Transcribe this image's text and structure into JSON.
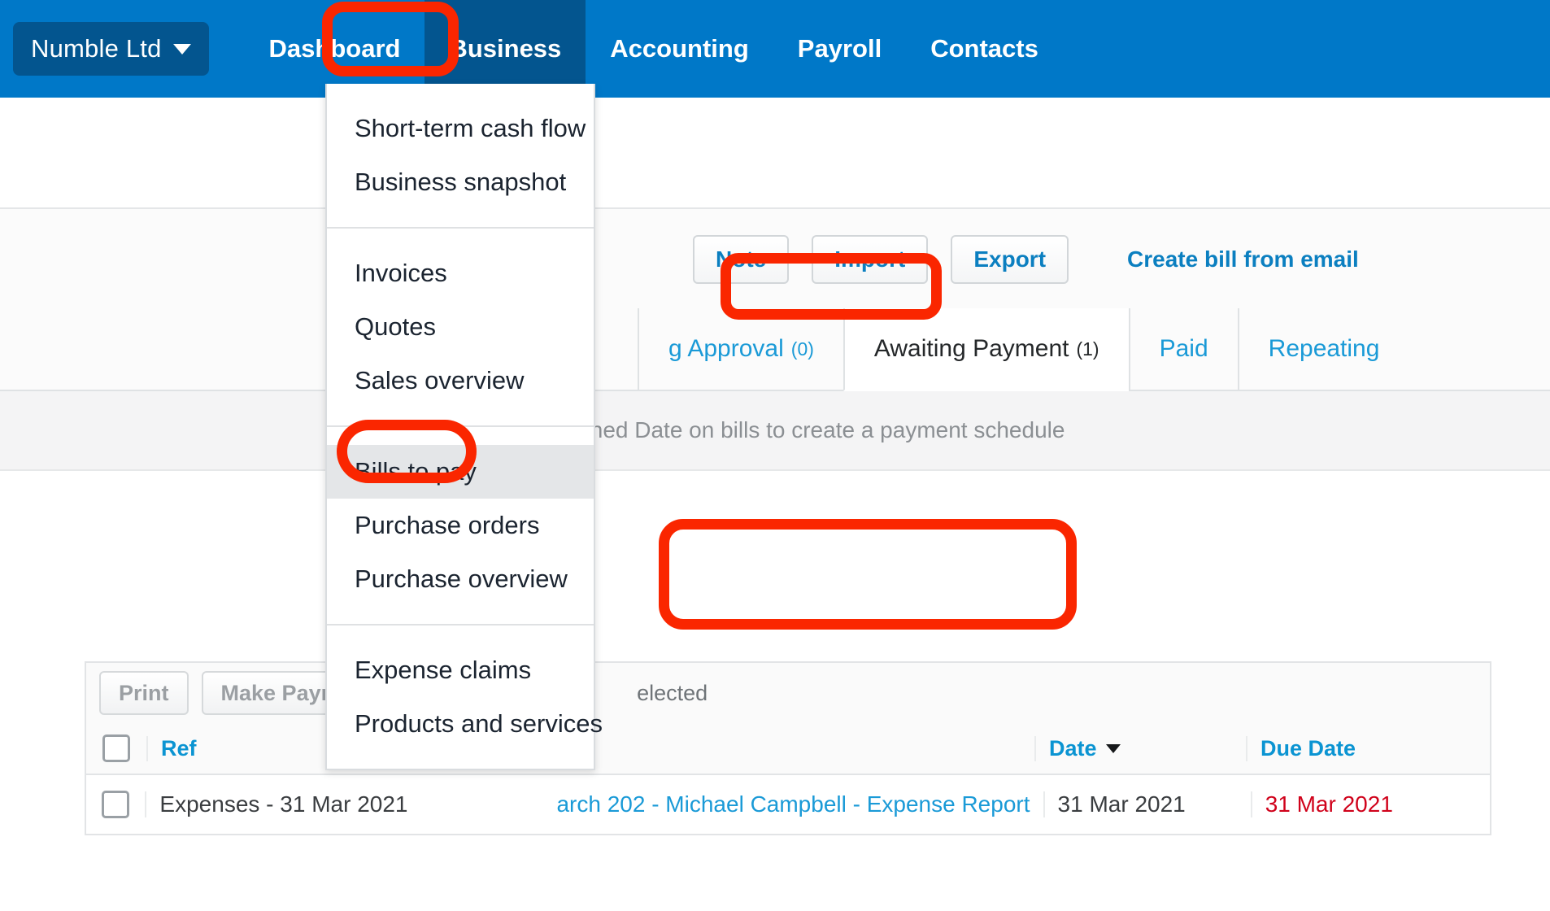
{
  "topnav": {
    "org": {
      "label": "Numble Ltd",
      "caret_icon": "chevron-down-icon"
    },
    "items": [
      {
        "label": "Dashboard",
        "active": false
      },
      {
        "label": "Business",
        "active": true
      },
      {
        "label": "Accounting",
        "active": false
      },
      {
        "label": "Payroll",
        "active": false
      },
      {
        "label": "Contacts",
        "active": false
      }
    ],
    "bg_color": "#0078c8",
    "active_bg_color": "#03558f"
  },
  "menu": {
    "groups": [
      {
        "items": [
          {
            "label": "Short-term cash flow",
            "highlighted": false
          },
          {
            "label": "Business snapshot",
            "highlighted": false
          }
        ]
      },
      {
        "items": [
          {
            "label": "Invoices",
            "highlighted": false
          },
          {
            "label": "Quotes",
            "highlighted": false
          },
          {
            "label": "Sales overview",
            "highlighted": false
          }
        ]
      },
      {
        "items": [
          {
            "label": "Bills to pay",
            "highlighted": true
          },
          {
            "label": "Purchase orders",
            "highlighted": false
          },
          {
            "label": "Purchase overview",
            "highlighted": false
          }
        ]
      },
      {
        "items": [
          {
            "label": "Expense claims",
            "highlighted": false
          },
          {
            "label": "Products and services",
            "highlighted": false
          }
        ]
      }
    ]
  },
  "toolbar": {
    "buttons": [
      {
        "label": "Note"
      },
      {
        "label": "Import"
      },
      {
        "label": "Export"
      }
    ],
    "link": "Create bill from email"
  },
  "tabs": [
    {
      "label": "g Approval",
      "count": "(0)",
      "active": false
    },
    {
      "label": "Awaiting Payment",
      "count": "(1)",
      "active": true
    },
    {
      "label": "Paid",
      "count": "",
      "active": false
    },
    {
      "label": "Repeating",
      "count": "",
      "active": false
    }
  ],
  "notice": "Set a Planned Date on bills to create a payment schedule",
  "action_bar": {
    "buttons": [
      {
        "label": "Print"
      },
      {
        "label": "Make Payment"
      }
    ],
    "selected_text": "elected"
  },
  "table": {
    "headers": {
      "ref": "Ref",
      "to": "",
      "date": "Date",
      "due_date": "Due Date",
      "sort_icon": "sort-descending-caret-icon"
    },
    "rows": [
      {
        "checked": false,
        "ref": "Expenses - 31 Mar 2021",
        "to": "arch 202  - Michael Campbell - Expense Report",
        "date": "31 Mar 2021",
        "due_date": "31 Mar 2021"
      }
    ]
  },
  "annotations": {
    "color": "#fa2600",
    "boxes": [
      {
        "name": "business-nav-highlight"
      },
      {
        "name": "bills-to-pay-highlight"
      },
      {
        "name": "awaiting-payment-tab-highlight"
      },
      {
        "name": "bill-row-highlight"
      }
    ]
  }
}
